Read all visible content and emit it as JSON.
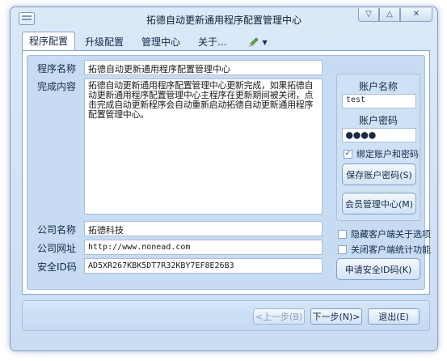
{
  "window": {
    "title": "拓德自动更新通用程序配置管理中心",
    "buttons": {
      "minimize": "▽",
      "maximize": "△",
      "close": "✕"
    }
  },
  "tabs": [
    {
      "label": "程序配置",
      "active": true
    },
    {
      "label": "升级配置",
      "active": false
    },
    {
      "label": "管理中心",
      "active": false
    },
    {
      "label": "关于...",
      "active": false
    }
  ],
  "tab_extra": {
    "icon": "pencil-icon",
    "dropdown": "▼"
  },
  "form": {
    "program_name_label": "程序名称",
    "program_name_value": "拓德自动更新通用程序配置管理中心",
    "content_label": "完成内容",
    "content_value": "拓德自动更新通用程序配置管理中心更新完成，如果拓德自动更新通用程序配置管理中心主程序在更新期间被关闭，点击完成自动更新程序会自动重新启动拓德自动更新通用程序配置管理中心。",
    "company_name_label": "公司名称",
    "company_name_value": "拓德科技",
    "company_url_label": "公司网址",
    "company_url_value": "http://www.nonead.com",
    "security_id_label": "安全ID码",
    "security_id_value": "AD5XR267KBK5DT7R32KBY7EF8E26B3"
  },
  "account": {
    "name_label": "账户名称",
    "name_value": "test",
    "password_label": "账户密码",
    "password_value": "●●●●",
    "bind_label": "绑定账户和密码",
    "bind_checked": true,
    "save_button": "保存账户密码(S)",
    "member_button": "会员管理中心(M)"
  },
  "options": {
    "hide_about": {
      "label": "隐藏客户端关于选项",
      "checked": false
    },
    "disable_stats": {
      "label": "关闭客户端统计功能",
      "checked": false
    },
    "request_id_button": "申请安全ID码(K)"
  },
  "footer": {
    "prev_button": "<上一步(B)",
    "next_button": "下一步(N)>",
    "exit_button": "退出(E)"
  }
}
